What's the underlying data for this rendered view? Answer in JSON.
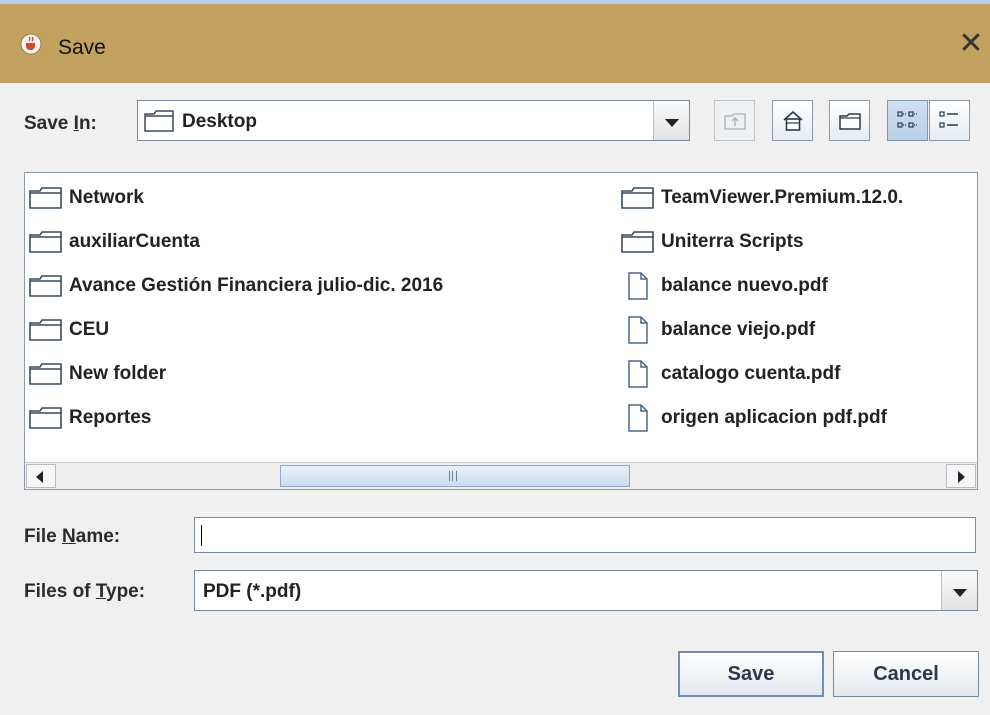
{
  "window": {
    "title": "Save",
    "app_icon": "java-cup-icon",
    "close_symbol": "✕"
  },
  "save_in": {
    "label_prefix": "Save ",
    "label_mnemonic": "I",
    "label_suffix": "n:",
    "value": "Desktop"
  },
  "toolbar": {
    "buttons": [
      {
        "name": "up-one-level-button",
        "icon": "folder-up-icon",
        "enabled": false
      },
      {
        "name": "home-button",
        "icon": "home-icon",
        "enabled": true
      },
      {
        "name": "new-folder-button",
        "icon": "new-folder-icon",
        "enabled": true
      },
      {
        "name": "list-view-button",
        "icon": "list-view-icon",
        "selected": true
      },
      {
        "name": "details-view-button",
        "icon": "details-view-icon",
        "selected": false
      }
    ]
  },
  "files": {
    "left_column": [
      {
        "name": "Network",
        "type": "folder"
      },
      {
        "name": "auxiliarCuenta",
        "type": "folder"
      },
      {
        "name": "Avance Gestión Financiera julio-dic. 2016",
        "type": "folder"
      },
      {
        "name": "CEU",
        "type": "folder"
      },
      {
        "name": "New folder",
        "type": "folder"
      },
      {
        "name": "Reportes",
        "type": "folder"
      }
    ],
    "right_column": [
      {
        "name": "TeamViewer.Premium.12.0.",
        "type": "folder"
      },
      {
        "name": "Uniterra Scripts",
        "type": "folder"
      },
      {
        "name": "balance nuevo.pdf",
        "type": "file"
      },
      {
        "name": "balance viejo.pdf",
        "type": "file"
      },
      {
        "name": "catalogo cuenta.pdf",
        "type": "file"
      },
      {
        "name": "origen aplicacion pdf.pdf",
        "type": "file"
      }
    ]
  },
  "file_name": {
    "label_prefix": "File ",
    "label_mnemonic": "N",
    "label_suffix": "ame:",
    "value": ""
  },
  "file_type": {
    "label_prefix": "Files of ",
    "label_mnemonic": "T",
    "label_suffix": "ype:",
    "value": "PDF (*.pdf)"
  },
  "buttons": {
    "save": "Save",
    "cancel": "Cancel"
  }
}
